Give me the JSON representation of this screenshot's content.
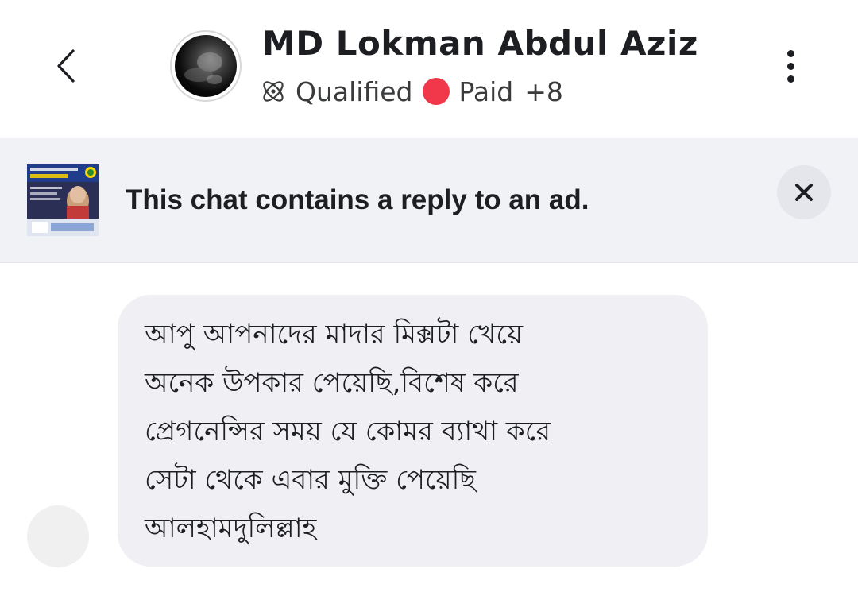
{
  "header": {
    "back_icon": "chevron-left-icon",
    "contact_name": "MD Lokman Abdul Aziz",
    "labels": {
      "qualified_icon": "atom-icon",
      "qualified": "Qualified",
      "paid_color": "#f0384a",
      "paid": "Paid",
      "more_count": "+8"
    },
    "menu_icon": "more-vertical-icon"
  },
  "ad_banner": {
    "text": "This chat contains a reply to an ad.",
    "close_icon": "close-icon"
  },
  "message": {
    "lines": [
      "আপু আপনাদের মাদার মিক্সটা খেয়ে",
      "অনেক উপকার পেয়েছি,বিশেষ করে",
      "প্রেগনেন্সির সময় যে কোমর ব্যাথা করে",
      "সেটা থেকে এবার মুক্তি পেয়েছি",
      "আলহামদুলিল্লাহ"
    ]
  },
  "colors": {
    "bubble": "#f0f0f4",
    "banner": "#f0f2f5",
    "text": "#1c1e21"
  }
}
